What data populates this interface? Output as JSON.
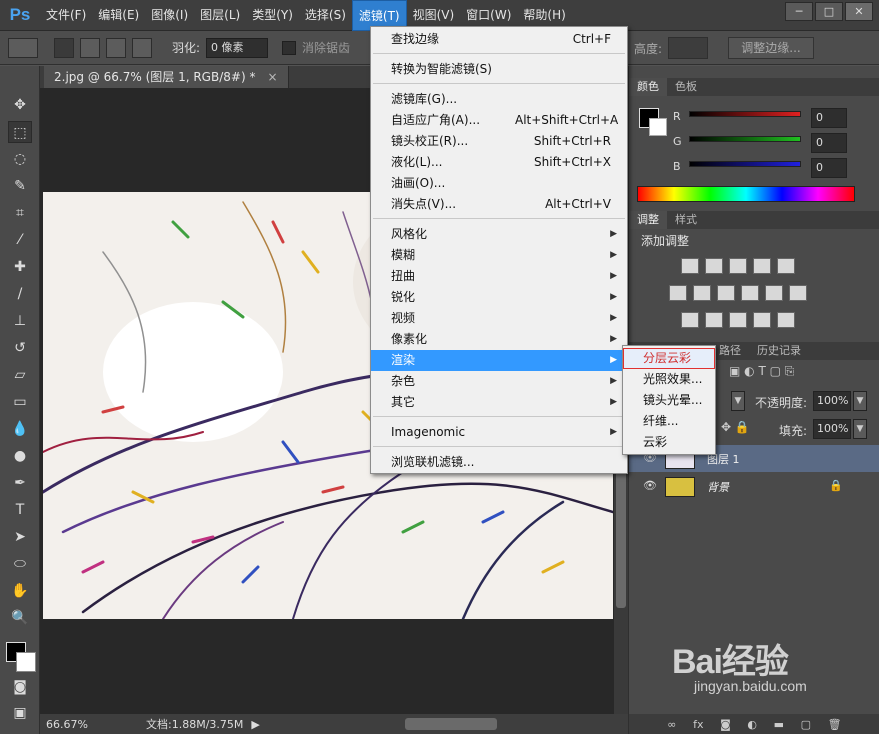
{
  "app": {
    "logo": "Ps"
  },
  "menubar": {
    "items": [
      "文件(F)",
      "编辑(E)",
      "图像(I)",
      "图层(L)",
      "类型(Y)",
      "选择(S)",
      "滤镜(T)",
      "视图(V)",
      "窗口(W)",
      "帮助(H)"
    ],
    "active_index": 6
  },
  "window_controls": {
    "minimize": "─",
    "restore": "□",
    "close": "✕"
  },
  "options": {
    "feather_label": "羽化:",
    "feather_value": "0 像素",
    "antialias_label": "消除锯齿",
    "height_label": "高度:",
    "refine_edge": "调整边缘..."
  },
  "document": {
    "tab_title": "2.jpg @ 66.7% (图层 1, RGB/8#) *",
    "tab_close": "×",
    "zoom": "66.67%",
    "doc_info": "文档:1.88M/3.75M"
  },
  "filter_menu": {
    "items": [
      {
        "label": "查找边缘",
        "shortcut": "Ctrl+F"
      },
      {
        "label": "转换为智能滤镜(S)"
      },
      {
        "label": "滤镜库(G)..."
      },
      {
        "label": "自适应广角(A)...",
        "shortcut": "Alt+Shift+Ctrl+A"
      },
      {
        "label": "镜头校正(R)...",
        "shortcut": "Shift+Ctrl+R"
      },
      {
        "label": "液化(L)...",
        "shortcut": "Shift+Ctrl+X"
      },
      {
        "label": "油画(O)..."
      },
      {
        "label": "消失点(V)...",
        "shortcut": "Alt+Ctrl+V"
      },
      {
        "label": "风格化",
        "arrow": "▶"
      },
      {
        "label": "模糊",
        "arrow": "▶"
      },
      {
        "label": "扭曲",
        "arrow": "▶"
      },
      {
        "label": "锐化",
        "arrow": "▶"
      },
      {
        "label": "视频",
        "arrow": "▶"
      },
      {
        "label": "像素化",
        "arrow": "▶"
      },
      {
        "label": "渲染",
        "arrow": "▶"
      },
      {
        "label": "杂色",
        "arrow": "▶"
      },
      {
        "label": "其它",
        "arrow": "▶"
      },
      {
        "label": "Imagenomic",
        "arrow": "▶"
      },
      {
        "label": "浏览联机滤镜..."
      }
    ]
  },
  "render_submenu": {
    "items": [
      "分层云彩",
      "光照效果...",
      "镜头光晕...",
      "纤维...",
      "云彩"
    ]
  },
  "color_panel": {
    "tabs": [
      "颜色",
      "色板"
    ],
    "channels": [
      {
        "label": "R",
        "value": "0",
        "color": "#e02020"
      },
      {
        "label": "G",
        "value": "0",
        "color": "#20c020"
      },
      {
        "label": "B",
        "value": "0",
        "color": "#2020e0"
      }
    ]
  },
  "adjustments_panel": {
    "tabs": [
      "调整",
      "样式"
    ],
    "title": "添加调整"
  },
  "layers_panel": {
    "tabs": [
      "路径",
      "历史记录"
    ],
    "opacity_label": "不透明度:",
    "opacity_value": "100%",
    "fill_label": "填充:",
    "fill_value": "100%",
    "layers": [
      {
        "name": "图层 1",
        "selected": true
      },
      {
        "name": "背景",
        "selected": false,
        "locked": true
      }
    ],
    "footer_icons": [
      "link-icon",
      "fx-icon",
      "mask-icon",
      "adjustment-icon",
      "group-icon",
      "new-layer-icon",
      "trash-icon"
    ]
  },
  "watermark": {
    "logo_text": "Bai经验",
    "url": "jingyan.baidu.com"
  }
}
